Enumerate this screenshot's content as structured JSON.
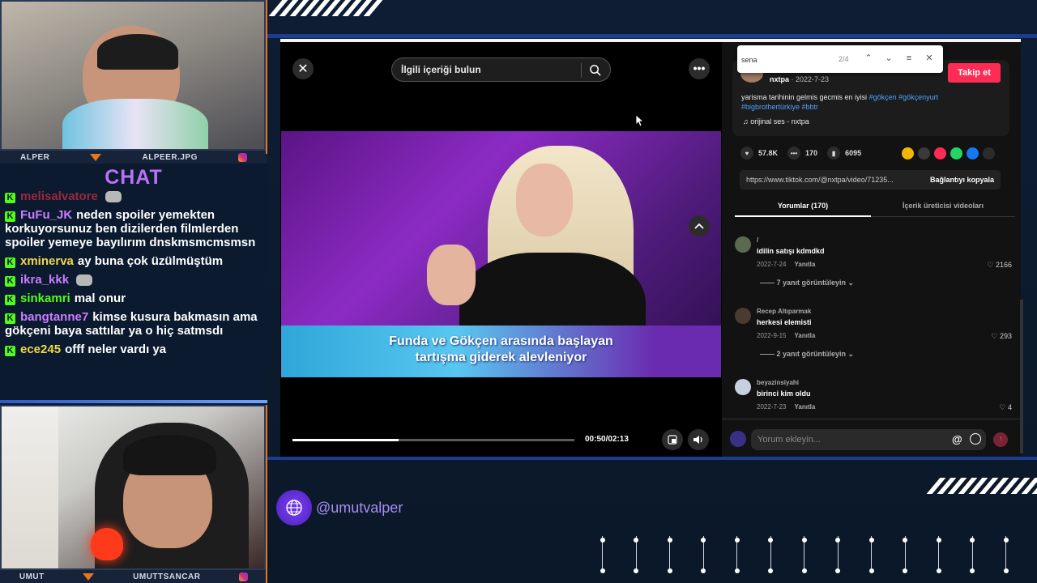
{
  "streamers": {
    "top": {
      "left_name": "ALPER",
      "right_name": "ALPEER.JPG"
    },
    "bottom": {
      "left_name": "UMUT",
      "right_name": "UMUTTSANCAR"
    }
  },
  "chat": {
    "title": "CHAT",
    "messages": [
      {
        "user": "melisalvatore",
        "text": "",
        "user_color": "#9a2a3c",
        "emote": true
      },
      {
        "user": "FuFu_JK",
        "text": "neden spoiler yemekten korkuyorsunuz ben dizilerden filmlerden spoiler yemeye bayılırım dnskmsmcmsmsn",
        "user_color": "#c97dff"
      },
      {
        "user": "xminerva",
        "text": "ay buna çok üzülmüştüm",
        "user_color": "#f2d84a"
      },
      {
        "user": "ikra_kkk",
        "text": "",
        "user_color": "#c97dff",
        "emote": true
      },
      {
        "user": "sinkamri",
        "text": "mal onur",
        "user_color": "#53fc18"
      },
      {
        "user": "bangtanne7",
        "text": "kimse kusura bakmasın ama gökçeni baya sattılar ya o hiç satmsdı",
        "user_color": "#c97dff"
      },
      {
        "user": "ece245",
        "text": "offf neler vardı ya",
        "user_color": "#f2d84a"
      }
    ]
  },
  "video": {
    "search_placeholder": "İlgili içeriği bulun",
    "caption_line1": "Funda ve Gökçen arasında başlayan",
    "caption_line2": "tartışma giderek alevleniyor",
    "timecode": "00:50/02:13",
    "progress": 0.376
  },
  "find_bar": {
    "query": "sena",
    "count": "2/4"
  },
  "post": {
    "follow_label": "Takip et",
    "author": "nxtpa",
    "date": "2022-7-23",
    "description": "yarisma tarihinin gelmis gecmis en iyisi",
    "tags": "#gökçen #gökçenyurt #bigbrothertürkiye #bbtr",
    "sound": "orijinal ses - nxtpa",
    "likes": "57.8K",
    "comments": "170",
    "saves": "6095",
    "link": "https://www.tiktok.com/@nxtpa/video/71235...",
    "copy_label": "Bağlantıyı kopyala",
    "tab_comments": "Yorumlar (170)",
    "tab_creator": "İçerik üreticisi videoları",
    "share_colors": [
      "#f2b705",
      "#3a3a3a",
      "#fe2c55",
      "#25d366",
      "#1877f2",
      "#2c2c2c"
    ]
  },
  "comments": [
    {
      "name": "/",
      "text": "idilin satışı kdmdkd",
      "date": "2022-7-24",
      "reply": "Yanıtla",
      "likes": "2166",
      "replies": "7 yanıt görüntüleyin"
    },
    {
      "name": "Recep Altıparmak",
      "text": "herkesi elemisti",
      "date": "2022-9-15",
      "reply": "Yanıtla",
      "likes": "293",
      "replies": "2 yanıt görüntüleyin"
    },
    {
      "name": "beyazinsiyahi",
      "text": "birinci kim oldu",
      "date": "2022-7-23",
      "reply": "Yanıtla",
      "likes": "4",
      "replies": ""
    }
  ],
  "comment_input": {
    "placeholder": "Yorum ekleyin...",
    "at": "@"
  },
  "overlay": {
    "handle": "@umutvalper"
  }
}
